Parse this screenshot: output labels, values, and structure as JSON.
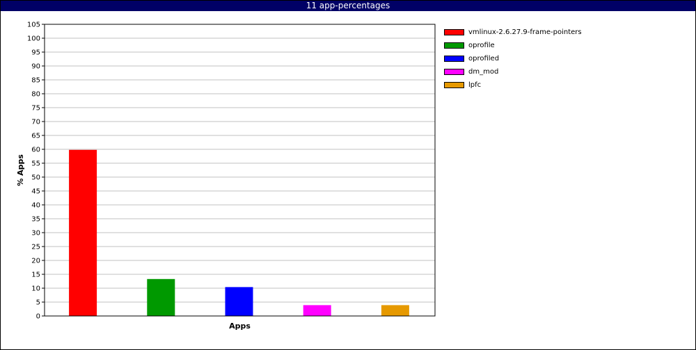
{
  "chart_data": {
    "type": "bar",
    "title": "11 app-percentages",
    "xlabel": "Apps",
    "ylabel": "% Apps",
    "ylim": [
      0,
      105
    ],
    "ytick_step": 5,
    "grid": true,
    "legend_position": "right",
    "series": [
      {
        "name": "vmlinux-2.6.27.9-frame-pointers",
        "value": 59.8,
        "color": "#ff0000"
      },
      {
        "name": "oprofile",
        "value": 13.3,
        "color": "#009900"
      },
      {
        "name": "oprofiled",
        "value": 10.4,
        "color": "#0000ff"
      },
      {
        "name": "dm_mod",
        "value": 3.9,
        "color": "#ff00ff"
      },
      {
        "name": "lpfc",
        "value": 3.9,
        "color": "#e69900"
      }
    ]
  }
}
